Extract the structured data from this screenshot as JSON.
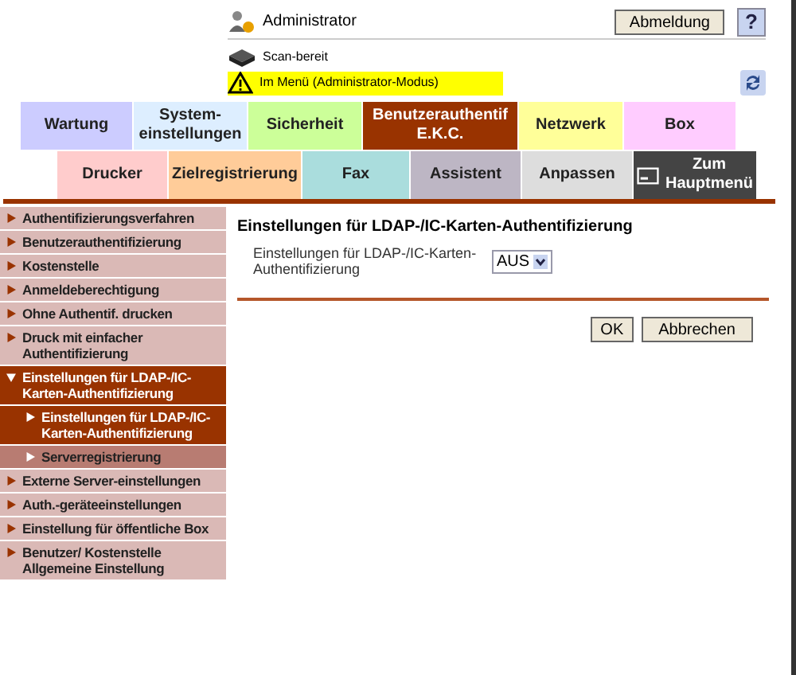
{
  "header": {
    "user": "Administrator",
    "logout_button": "Abmeldung",
    "help_button": "?",
    "status": "Scan-bereit",
    "warning": "Im Menü (Administrator-Modus)"
  },
  "tabs_row_1": [
    {
      "label": "Wartung",
      "color": "#ccccff",
      "selected": false
    },
    {
      "label": "System-\neinstellungen",
      "color": "#ddeeff",
      "selected": false
    },
    {
      "label": "Sicherheit",
      "color": "#ccff99",
      "selected": false
    },
    {
      "label": "Benutzerauthentif\nE.K.C.",
      "color": "#993300",
      "selected": true
    },
    {
      "label": "Netzwerk",
      "color": "#ffff99",
      "selected": false
    },
    {
      "label": "Box",
      "color": "#ffccff",
      "selected": false
    }
  ],
  "tabs_row_2": [
    {
      "label": "Drucker",
      "color": "#ffcccc",
      "kind": "tab"
    },
    {
      "label": "Zielregistrierung",
      "color": "#ffcc99",
      "kind": "tab"
    },
    {
      "label": "Fax",
      "color": "#aadddd",
      "kind": "tab"
    },
    {
      "label": "Assistent",
      "color": "#bdb6c4",
      "kind": "tab"
    },
    {
      "label": "Anpassen",
      "color": "#dddddd",
      "kind": "tab"
    },
    {
      "label": "Zum\nHauptmenü",
      "color": "#444444",
      "kind": "home"
    }
  ],
  "sidebar": {
    "items": [
      {
        "label": "Authentifizierungsverfahren",
        "expanded": false,
        "selected": false
      },
      {
        "label": "Benutzerauthentifizierung",
        "expanded": false,
        "selected": false
      },
      {
        "label": "Kostenstelle",
        "expanded": false,
        "selected": false
      },
      {
        "label": "Anmeldeberechtigung",
        "expanded": false,
        "selected": false
      },
      {
        "label": "Ohne Authentif. drucken",
        "expanded": false,
        "selected": false
      },
      {
        "label": "Druck mit einfacher Authentifizierung",
        "expanded": false,
        "selected": false
      },
      {
        "label": "Einstellungen für LDAP-/IC-Karten-Authentifizierung",
        "expanded": true,
        "selected": true,
        "children": [
          {
            "label": "Einstellungen für LDAP-/IC-Karten-Authentifizierung",
            "selected": true
          },
          {
            "label": "Serverregistrierung",
            "selected": false
          }
        ]
      },
      {
        "label": "Externe Server-einstellungen",
        "expanded": false,
        "selected": false
      },
      {
        "label": "Auth.-geräteeinstellungen",
        "expanded": false,
        "selected": false
      },
      {
        "label": "Einstellung für öffentliche Box",
        "expanded": false,
        "selected": false
      },
      {
        "label": "Benutzer/ Kostenstelle Allgemeine Einstellung",
        "expanded": false,
        "selected": false
      }
    ]
  },
  "content": {
    "title": "Einstellungen für LDAP-/IC-Karten-Authentifizierung",
    "setting_label": "Einstellungen für LDAP-/IC-Karten-Authentifizierung",
    "setting_value": "AUS",
    "buttons": [
      "OK",
      "Abbrechen"
    ]
  }
}
